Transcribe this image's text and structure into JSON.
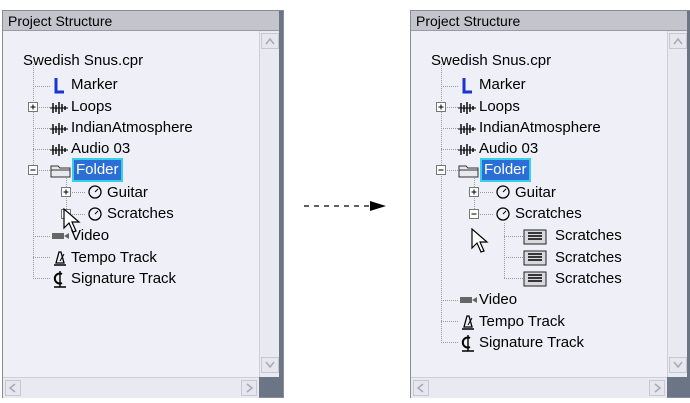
{
  "left_panel": {
    "title": "Project Structure",
    "project_name": "Swedish Snus.cpr",
    "items": {
      "marker": "Marker",
      "loops": "Loops",
      "indian": "IndianAtmosphere",
      "audio03": "Audio 03",
      "folder": "Folder",
      "guitar": "Guitar",
      "scratches": "Scratches",
      "video": "Video",
      "tempo": "Tempo Track",
      "signature": "Signature Track"
    }
  },
  "right_panel": {
    "title": "Project Structure",
    "project_name": "Swedish Snus.cpr",
    "items": {
      "marker": "Marker",
      "loops": "Loops",
      "indian": "IndianAtmosphere",
      "audio03": "Audio 03",
      "folder": "Folder",
      "guitar": "Guitar",
      "scratches": "Scratches",
      "scratches_part1": "Scratches",
      "scratches_part2": "Scratches",
      "scratches_part3": "Scratches",
      "video": "Video",
      "tempo": "Tempo Track",
      "signature": "Signature Track"
    }
  },
  "colors": {
    "selection": "#2b6fd6",
    "selection_outline": "#38d0e8",
    "panel_background": "#efeff7",
    "title_bar": "#c4c4cc"
  }
}
